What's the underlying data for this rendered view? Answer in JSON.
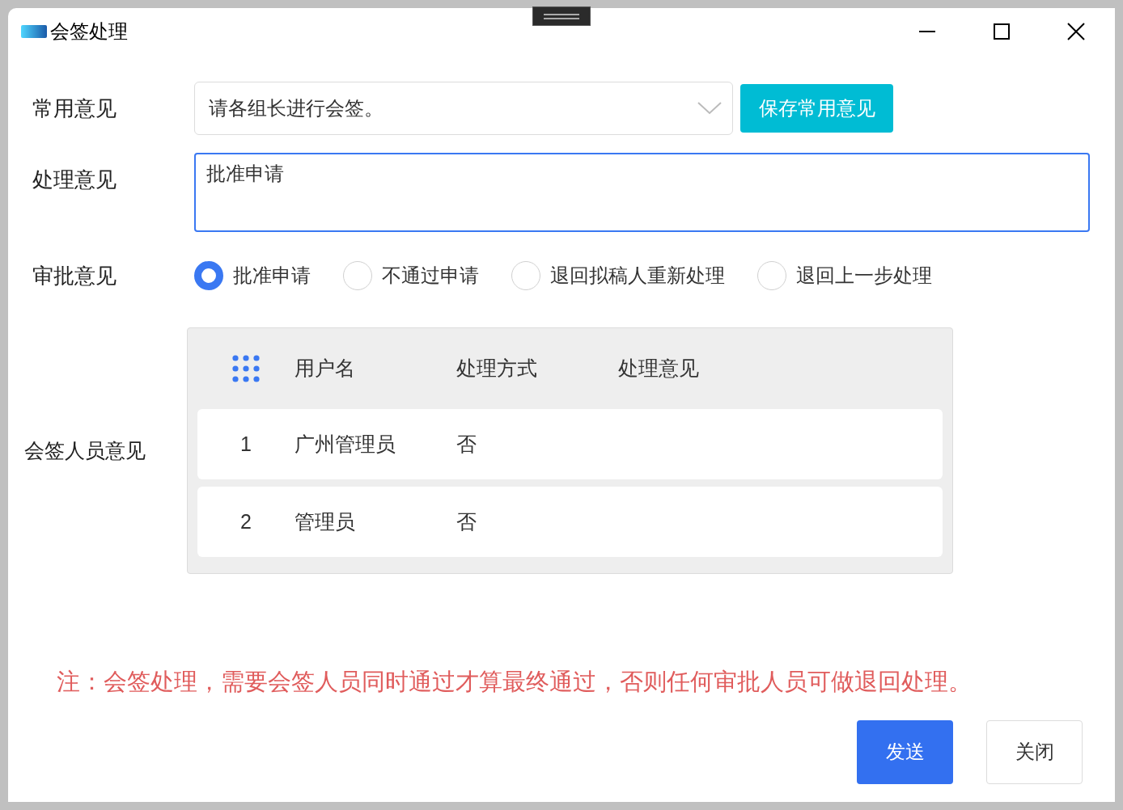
{
  "window": {
    "title": "会签处理"
  },
  "common_opinion": {
    "label": "常用意见",
    "value": "请各组长进行会签。",
    "save_button": "保存常用意见"
  },
  "handling_opinion": {
    "label": "处理意见",
    "value": "批准申请"
  },
  "approval": {
    "label": "审批意见",
    "options": [
      {
        "label": "批准申请",
        "selected": true
      },
      {
        "label": "不通过申请",
        "selected": false
      },
      {
        "label": "退回拟稿人重新处理",
        "selected": false
      },
      {
        "label": "退回上一步处理",
        "selected": false
      }
    ]
  },
  "countersign": {
    "label": "会签人员意见",
    "columns": [
      "用户名",
      "处理方式",
      "处理意见"
    ],
    "rows": [
      {
        "index": "1",
        "username": "广州管理员",
        "method": "否"
      },
      {
        "index": "2",
        "username": "管理员",
        "method": "否"
      }
    ]
  },
  "note": "注：会签处理，需要会签人员同时通过才算最终通过，否则任何审批人员可做退回处理。",
  "buttons": [
    {
      "label": "发送",
      "kind": "primary"
    },
    {
      "label": "关闭",
      "kind": "default"
    }
  ]
}
